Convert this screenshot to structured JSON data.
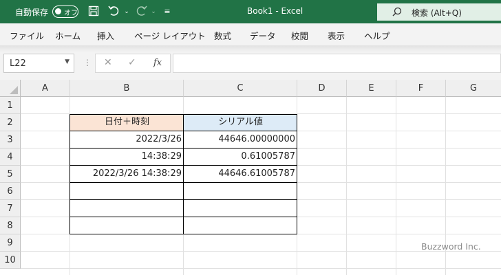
{
  "titlebar": {
    "autosave_label": "自動保存",
    "toggle_state": "オフ",
    "doc_title": "Book1  -  Excel",
    "search_label": "検索 (Alt+Q)"
  },
  "menu": [
    {
      "label": "ファイル"
    },
    {
      "label": "ホーム"
    },
    {
      "label": "挿入"
    },
    {
      "label": "ページ レイアウト"
    },
    {
      "label": "数式"
    },
    {
      "label": "データ"
    },
    {
      "label": "校閲"
    },
    {
      "label": "表示"
    },
    {
      "label": "ヘルプ"
    }
  ],
  "formula_bar": {
    "name_box": "L22",
    "formula": ""
  },
  "columns": [
    "A",
    "B",
    "C",
    "D",
    "E",
    "F",
    "G"
  ],
  "rows": [
    "1",
    "2",
    "3",
    "4",
    "5",
    "6",
    "7",
    "8",
    "9",
    "10"
  ],
  "table": {
    "header_b": "日付＋時刻",
    "header_c": "シリアル値",
    "b3": "2022/3/26",
    "c3": "44646.00000000",
    "b4": "14:38:29",
    "c4": "0.61005787",
    "b5": "2022/3/26 14:38:29",
    "c5": "44646.61005787"
  },
  "watermark": "Buzzword Inc.",
  "colors": {
    "excel_green": "#217346",
    "header_b_fill": "#fbe4d5",
    "header_c_fill": "#ddebf7"
  }
}
